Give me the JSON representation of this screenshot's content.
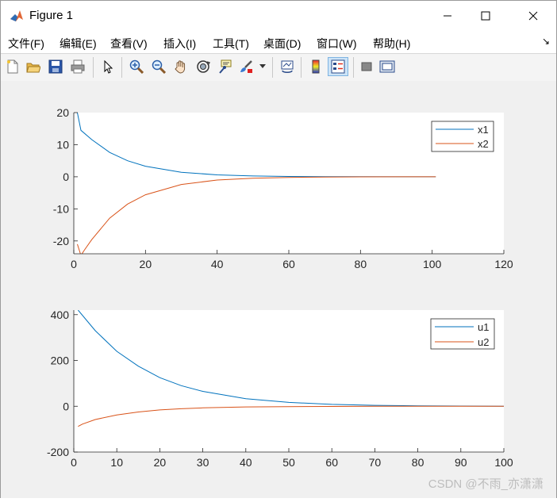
{
  "window": {
    "title": "Figure 1",
    "minimize": "—",
    "maximize": "☐",
    "close": "✕"
  },
  "menu": {
    "items": [
      "文件(F)",
      "编辑(E)",
      "查看(V)",
      "插入(I)",
      "工具(T)",
      "桌面(D)",
      "窗口(W)",
      "帮助(H)"
    ],
    "overflow_icon": "↘"
  },
  "toolbar": {
    "icons": [
      "new-figure-icon",
      "open-icon",
      "save-icon",
      "print-icon",
      "pointer-icon",
      "zoom-in-icon",
      "zoom-out-icon",
      "pan-icon",
      "rotate-3d-icon",
      "data-cursor-icon",
      "brush-icon",
      "brush-dropdown-icon",
      "link-plot-icon",
      "colorbar-icon",
      "legend-icon",
      "hide-plot-tools-icon",
      "show-plot-tools-icon"
    ],
    "active": "legend-icon"
  },
  "colors": {
    "series1": "#0072bd",
    "series2": "#d95319"
  },
  "chart_data": [
    {
      "type": "line",
      "xlim": [
        0,
        120
      ],
      "ylim": [
        -24,
        20
      ],
      "xticks": [
        0,
        20,
        40,
        60,
        80,
        100,
        120
      ],
      "yticks": [
        -20,
        -10,
        0,
        10,
        20
      ],
      "xtick_labels": [
        "0",
        "20",
        "40",
        "60",
        "80",
        "100",
        "120"
      ],
      "ytick_labels": [
        "-20",
        "-10",
        "0",
        "10",
        "20"
      ],
      "legend_position": "top-right",
      "series": [
        {
          "name": "x1",
          "color": "#0072bd",
          "x": [
            1,
            2,
            5,
            10,
            15,
            20,
            30,
            40,
            50,
            60,
            70,
            80,
            90,
            101
          ],
          "y": [
            20,
            14.5,
            11.6,
            7.6,
            5.0,
            3.3,
            1.4,
            0.6,
            0.25,
            0.1,
            0.04,
            0.02,
            0.01,
            0
          ]
        },
        {
          "name": "x2",
          "color": "#d95319",
          "x": [
            1,
            2,
            3,
            5,
            10,
            15,
            20,
            30,
            40,
            50,
            60,
            70,
            80,
            90,
            101
          ],
          "y": [
            -21,
            -24.5,
            -22.8,
            -19.6,
            -12.9,
            -8.5,
            -5.6,
            -2.4,
            -1.0,
            -0.45,
            -0.2,
            -0.08,
            -0.03,
            -0.01,
            0
          ]
        }
      ]
    },
    {
      "type": "line",
      "xlim": [
        0,
        100
      ],
      "ylim": [
        -200,
        420
      ],
      "xticks": [
        0,
        10,
        20,
        30,
        40,
        50,
        60,
        70,
        80,
        90,
        100
      ],
      "yticks": [
        -200,
        0,
        200,
        400
      ],
      "xtick_labels": [
        "0",
        "10",
        "20",
        "30",
        "40",
        "50",
        "60",
        "70",
        "80",
        "90",
        "100"
      ],
      "ytick_labels": [
        "-200",
        "0",
        "200",
        "400"
      ],
      "legend_position": "top-right",
      "series": [
        {
          "name": "u1",
          "color": "#0072bd",
          "x": [
            1,
            5,
            10,
            15,
            20,
            25,
            30,
            40,
            50,
            60,
            70,
            80,
            90,
            100
          ],
          "y": [
            420,
            330,
            240,
            175,
            125,
            90,
            65,
            33,
            17,
            8,
            4,
            2,
            1,
            0
          ]
        },
        {
          "name": "u2",
          "color": "#d95319",
          "x": [
            1,
            2,
            5,
            10,
            15,
            20,
            25,
            30,
            40,
            50,
            60,
            70,
            80,
            90,
            100
          ],
          "y": [
            -88,
            -78,
            -58,
            -38,
            -25,
            -16,
            -11,
            -7,
            -3,
            -1.5,
            -0.7,
            -0.3,
            -0.1,
            -0.05,
            0
          ]
        }
      ]
    }
  ],
  "watermark": "CSDN @不雨_亦潇潇"
}
